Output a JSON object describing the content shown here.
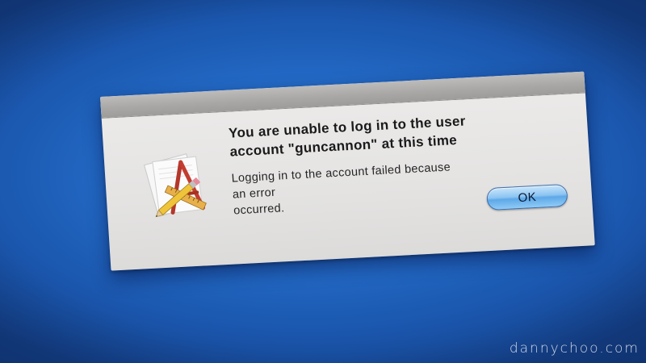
{
  "alert": {
    "title_line1": "You are unable to log in to the user",
    "title_line2": "account \"guncannon\" at this time",
    "message_line1": "Logging in to the account failed because an error",
    "message_line2": "occurred.",
    "ok_label": "OK",
    "icon": "application-pencil-icon"
  },
  "watermark": "dannychoo.com",
  "colors": {
    "desktop": "#2268c4",
    "dialog": "#e6e5e4",
    "button": "#8cc4f2"
  }
}
